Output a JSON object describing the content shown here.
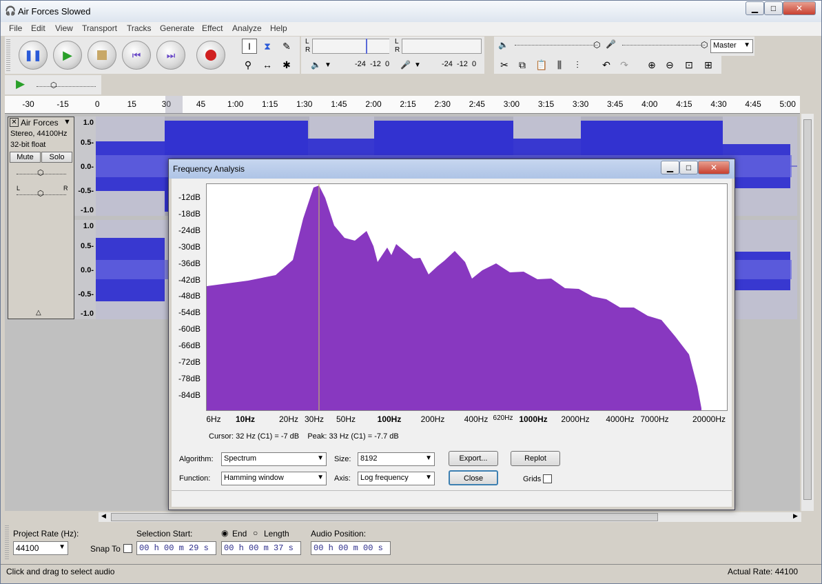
{
  "window": {
    "title": "Air Forces Slowed",
    "min": "▁",
    "max": "□",
    "close": "✕"
  },
  "menu": [
    "File",
    "Edit",
    "View",
    "Transport",
    "Tracks",
    "Generate",
    "Effect",
    "Analyze",
    "Help"
  ],
  "meters": {
    "l": "L",
    "r": "R",
    "scale1": "-24  -12  0",
    "scale2": "-24  -12  0"
  },
  "mixer": {
    "device": "Master"
  },
  "ruler": [
    "-30",
    "-15",
    "0",
    "15",
    "30",
    "45",
    "1:00",
    "1:15",
    "1:30",
    "1:45",
    "2:00",
    "2:15",
    "2:30",
    "2:45",
    "3:00",
    "3:15",
    "3:30",
    "3:45",
    "4:00",
    "4:15",
    "4:30",
    "4:45",
    "5:00"
  ],
  "track": {
    "name": "Air Forces",
    "info1": "Stereo, 44100Hz",
    "info2": "32-bit float",
    "mute": "Mute",
    "solo": "Solo",
    "l": "L",
    "r": "R",
    "scale1": [
      "1.0",
      "0.5-",
      "0.0-",
      "-0.5-",
      "-1.0"
    ],
    "scale2": [
      "1.0",
      "0.5-",
      "0.0-",
      "-0.5-",
      "-1.0"
    ]
  },
  "dialog": {
    "title": "Frequency Analysis",
    "ylabels": [
      "-12dB",
      "-18dB",
      "-24dB",
      "-30dB",
      "-36dB",
      "-42dB",
      "-48dB",
      "-54dB",
      "-60dB",
      "-66dB",
      "-72dB",
      "-78dB",
      "-84dB"
    ],
    "xlabels": [
      "6Hz",
      "10Hz",
      "20Hz",
      "30Hz",
      "50Hz",
      "100Hz",
      "200Hz",
      "400Hz",
      "620Hz",
      "1000Hz",
      "2000Hz",
      "4000Hz",
      "7000Hz",
      "20000Hz"
    ],
    "cursor": "Cursor: 32 Hz (C1) = -7 dB    Peak: 33 Hz (C1) = -7.7 dB",
    "algorithm_label": "Algorithm:",
    "algorithm": "Spectrum",
    "size_label": "Size:",
    "size": "8192",
    "function_label": "Function:",
    "function": "Hamming window",
    "axis_label": "Axis:",
    "axis": "Log frequency",
    "export": "Export...",
    "replot": "Replot",
    "close": "Close",
    "grids": "Grids",
    "color": "#8838c0"
  },
  "selection": {
    "rate_label": "Project Rate (Hz):",
    "rate": "44100",
    "snap": "Snap To",
    "start_label": "Selection Start:",
    "end": "End",
    "length": "Length",
    "pos_label": "Audio Position:",
    "start": "00 h 00 m 29 s",
    "endval": "00 h 00 m 37 s",
    "pos": "00 h 00 m 00 s"
  },
  "status": {
    "left": "Click and drag to select audio",
    "right": "Actual Rate: 44100"
  }
}
